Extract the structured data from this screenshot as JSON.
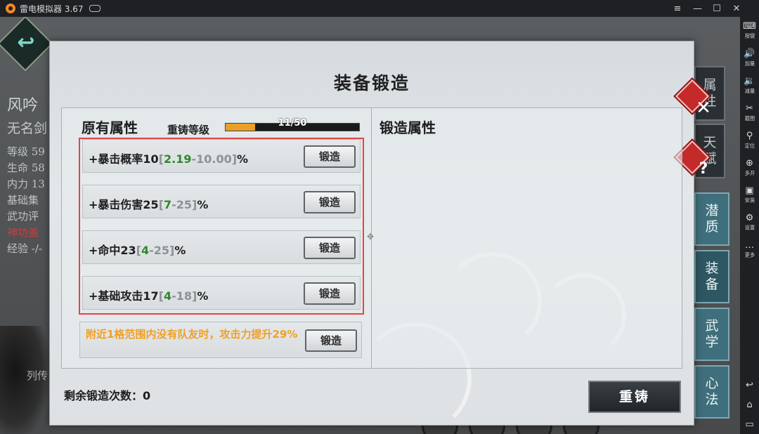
{
  "emulator": {
    "title": "雷电模拟器 3.67",
    "controls": [
      "≡",
      "—",
      "☐",
      "✕"
    ],
    "sidebar": [
      {
        "icon": "⌨",
        "label": "按键"
      },
      {
        "icon": "🔊",
        "label": "加量"
      },
      {
        "icon": "🔉",
        "label": "减量"
      },
      {
        "icon": "✂",
        "label": "截图"
      },
      {
        "icon": "⚲",
        "label": "定位"
      },
      {
        "icon": "⊕",
        "label": "多开"
      },
      {
        "icon": "▣",
        "label": "安装"
      },
      {
        "icon": "⚙",
        "label": "设置"
      },
      {
        "icon": "…",
        "label": "更多"
      }
    ],
    "nav": [
      "↩",
      "⌂",
      "▭"
    ]
  },
  "background": {
    "stats": {
      "name": "风吟",
      "sub": "无名剑",
      "rows": [
        "等级 59",
        "生命 58",
        "内力 13",
        "基础集",
        "武功评",
        "神功盖",
        "经验 -/-"
      ]
    },
    "lie_zhuan": "列传",
    "upper_tabs": [
      [
        "属",
        "性"
      ],
      [
        "天",
        "赋"
      ]
    ],
    "tabs": [
      [
        "潜",
        "质"
      ],
      [
        "装",
        "备"
      ],
      [
        "武",
        "学"
      ],
      [
        "心",
        "法"
      ]
    ]
  },
  "dialog": {
    "title": "装备锻造",
    "close_icon": "✕",
    "help_icon": "?",
    "left_title": "原有属性",
    "right_title": "锻造属性",
    "reforge_level_label": "重铸等级",
    "reforge_progress": {
      "current": 11,
      "max": 50,
      "text": "11/50"
    },
    "attributes": [
      {
        "name": "+暴击概率10",
        "open": "[",
        "min": "2.19",
        "dash": "-",
        "max": "10.00",
        "close": "]",
        "unit": "%",
        "button": "锻造"
      },
      {
        "name": "+暴击伤害25",
        "open": "[",
        "min": "7",
        "dash": "-",
        "max": "25",
        "close": "]",
        "unit": "%",
        "button": "锻造"
      },
      {
        "name": "+命中23",
        "open": "[",
        "min": "4",
        "dash": "-",
        "max": "25",
        "close": "]",
        "unit": "%",
        "button": "锻造"
      },
      {
        "name": "+基础攻击17",
        "open": "[",
        "min": "4",
        "dash": "-",
        "max": "18",
        "close": "]",
        "unit": "%",
        "button": "锻造"
      }
    ],
    "special": {
      "text": "附近1格范围内没有队友时，攻击力提升29%",
      "button": "锻造"
    },
    "remaining_label": "剩余锻造次数：",
    "remaining_value": "0",
    "reforge_button": "重铸"
  }
}
